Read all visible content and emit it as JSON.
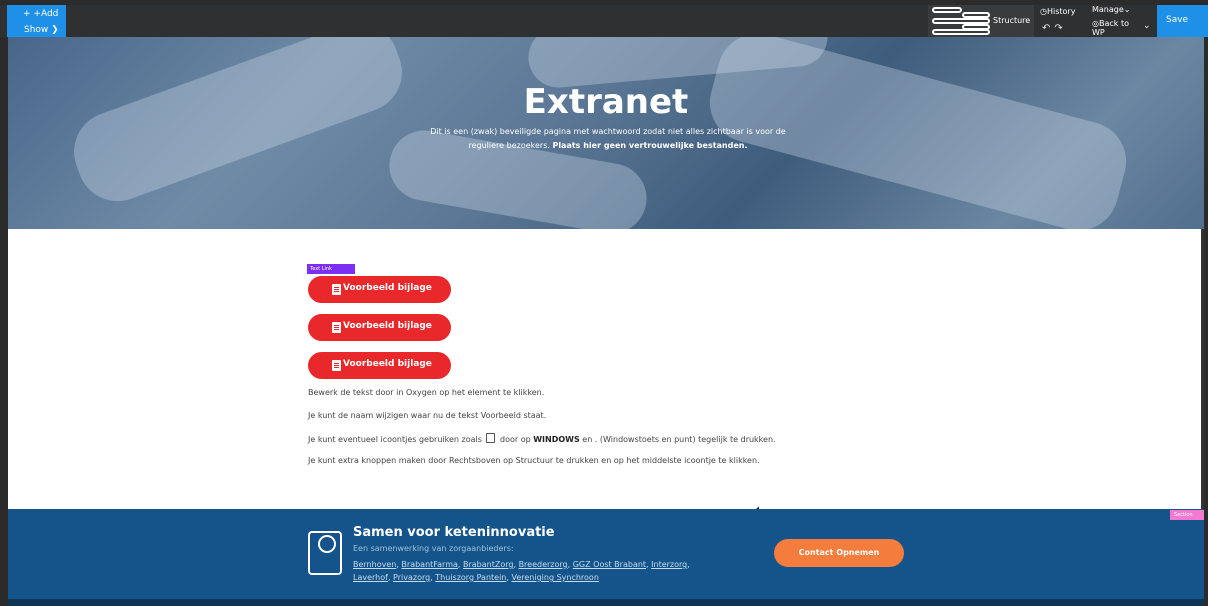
{
  "toolbar": {
    "add_label": "+ +Add",
    "show_label": "Show ❯",
    "structure_label": "Structure",
    "history_label": "History",
    "manage_label": "Manage",
    "back_label": "Back to WP",
    "save_label": "Save"
  },
  "hero": {
    "title": "Extranet",
    "text_plain": "Dit is een (zwak) beveiligde pagina met wachtwoord zodat niet alles zichtbaar is voor de reguliere bezoekers. ",
    "text_bold": "Plaats hier geen vertrouwelijke bestanden."
  },
  "editor": {
    "textlink_badge": "Text Link",
    "section_badge": "Section"
  },
  "buttons": [
    {
      "label": "Voorbeeld bijlage"
    },
    {
      "label": "Voorbeeld bijlage"
    },
    {
      "label": "Voorbeeld bijlage"
    }
  ],
  "paragraphs": {
    "p1": "Bewerk de tekst door in Oxygen op het element te klikken.",
    "p2": "Je kunt de naam wijzigen waar nu de tekst Voorbeeld staat.",
    "p3_a": "Je kunt eventueel icoontjes gebruiken zoals",
    "p3_b": "door op",
    "p3_bold": "WINDOWS",
    "p3_c": "en . (Windowstoets en punt) tegelijk te drukken.",
    "p4": "Je kunt extra knoppen maken door Rechtsboven op Structuur te drukken en op het middelste icoontje te klikken."
  },
  "footer": {
    "title": "Samen voor keteninnovatie",
    "subtitle": "Een samenwerking van zorgaanbieders:",
    "links": [
      "Bernhoven",
      "BrabantFarma",
      "BrabantZorg",
      "Breederzorg",
      "GGZ Oost Brabant",
      "Interzorg",
      "Laverhof",
      "Privazorg",
      "Thuiszorg Pantein",
      "Vereniging Synchroon"
    ],
    "cta": "Contact Opnemen"
  },
  "colors": {
    "accent_blue": "#1e90e8",
    "button_red": "#e8282b",
    "footer_blue": "#15548a",
    "cta_orange": "#f47c3c"
  }
}
